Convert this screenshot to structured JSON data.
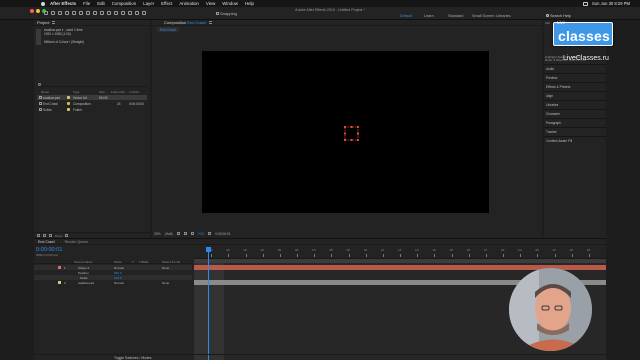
{
  "menubar": {
    "app": "After Effects",
    "items": [
      "File",
      "Edit",
      "Composition",
      "Layer",
      "Effect",
      "Animation",
      "View",
      "Window",
      "Help"
    ],
    "clock": "Sun Jun 30  8:29 PM"
  },
  "toolbar": {
    "snapping_label": "Snapping",
    "window_title": "Adobe After Effects 2019 - Untitled Project *",
    "workspaces": [
      "Default",
      "Learn",
      "Standard",
      "Small Screen",
      "Libraries"
    ],
    "active_workspace": "Default",
    "search_label": "Search Help"
  },
  "project": {
    "title": "Project",
    "selected_name": "swallow.psd ▾ , used 1 time",
    "selected_dims": "1920 x 1080 (1.00)",
    "selected_color": "Millions of Colors+ (Straight)",
    "columns": [
      "Name",
      "Type",
      "Size",
      "Frame Ra...",
      "In Point"
    ],
    "rows": [
      {
        "name": "swallow.psd",
        "type": "Vector Art",
        "size": "96 KB",
        "frame": "",
        "in": "",
        "label_color": "#d8c57a"
      },
      {
        "name": "End Crawl",
        "type": "Composition",
        "size": "",
        "frame": "24",
        "in": "0:00:00:00",
        "label_color": "#d8b94a"
      },
      {
        "name": "Solids",
        "type": "Folder",
        "size": "",
        "frame": "",
        "in": "",
        "label_color": "#d8c57a"
      }
    ],
    "bpc": "8 bpc"
  },
  "comp": {
    "title_prefix": "Composition",
    "title_name": "End Crawl",
    "tab": "End Crawl",
    "zoom": "33%",
    "resolution": "(Half)",
    "timecode": "0:00:00:01",
    "exposure": "+0.0"
  },
  "right_panel": {
    "info_lines": [
      "Info",
      "Highlight Selection Controls",
      "Rock: 3.6%(0.00, 0.02 0.0 0.0)"
    ],
    "items": [
      "Audio",
      "Preview",
      "Effects & Presets",
      "Align",
      "Libraries",
      "Character",
      "Paragraph",
      "Tracker",
      "Content-Aware Fill"
    ]
  },
  "logo": {
    "live": "Live",
    "word": "classes",
    "url": "LiveClasses.ru",
    "color": "#3f97e8"
  },
  "timeline": {
    "tabs": [
      "End Crawl",
      "Render Queue"
    ],
    "timecode": "0:00:00:01",
    "fps": "00001 (24.00 fps)",
    "columns": [
      "Source Name",
      "Mode",
      "T",
      "TrkMat",
      "Parent & Link"
    ],
    "layers": [
      {
        "num": "1",
        "name": "Shape 2",
        "mode": "Normal",
        "parent": "None",
        "color": "#d86a6a"
      },
      {
        "num": "",
        "name": "Position",
        "mode": "960.0",
        "parent": "",
        "color": ""
      },
      {
        "num": "",
        "name": "Scale",
        "mode": "100.0",
        "parent": "",
        "color": ""
      },
      {
        "num": "2",
        "name": "swallow.psd",
        "mode": "Normal",
        "parent": "None",
        "color": "#d8c57a"
      }
    ],
    "ruler_labels": [
      "01f",
      "02f",
      "03f",
      "04f",
      "05f",
      "06f",
      "07f",
      "08f",
      "09f",
      "10f",
      "11f",
      "12f",
      "13f",
      "14f",
      "15f",
      "16f",
      "17f",
      "18f",
      "19f",
      "20f",
      "21f",
      "22f",
      "23f"
    ],
    "footer": "Toggle Switches / Modes",
    "shape_bar_color": "#b85a4a",
    "swallow_bar_color": "#8a8a8a"
  }
}
